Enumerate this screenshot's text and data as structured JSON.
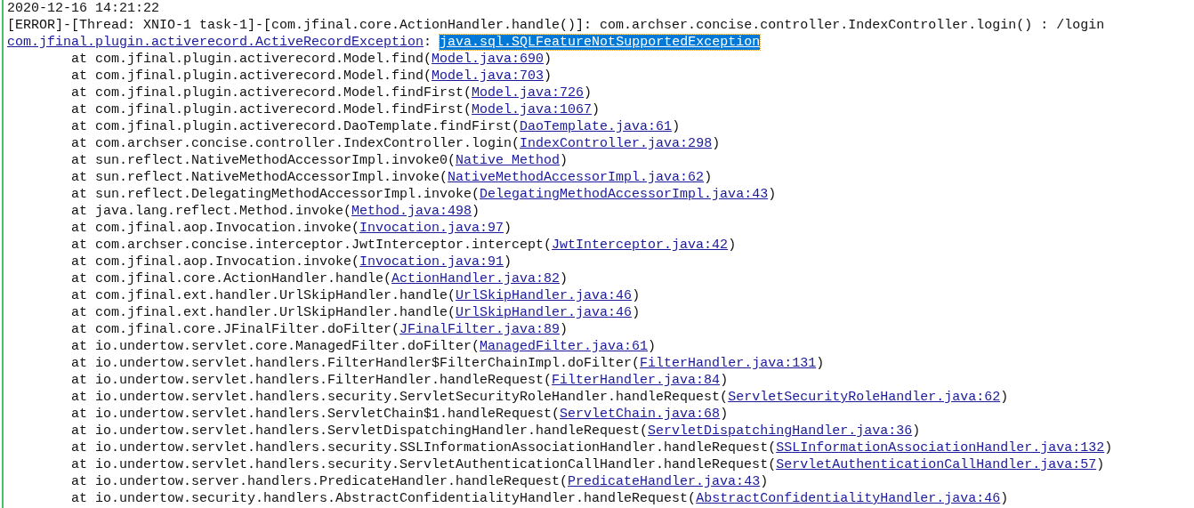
{
  "log": {
    "timestamp": "2020-12-16 14:21:22",
    "error_line": "[ERROR]-[Thread: XNIO-1 task-1]-[com.jfinal.core.ActionHandler.handle()]: com.archser.concise.controller.IndexController.login() : /login",
    "exception": {
      "link": "com.jfinal.plugin.activerecord.ActiveRecordException",
      "separator": ": ",
      "cause": "java.sql.SQLFeatureNotSupportedException",
      "selected": true
    },
    "frames": [
      {
        "prefix": "at com.jfinal.plugin.activerecord.Model.find(",
        "link": "Model.java:690",
        "suffix": ")"
      },
      {
        "prefix": "at com.jfinal.plugin.activerecord.Model.find(",
        "link": "Model.java:703",
        "suffix": ")"
      },
      {
        "prefix": "at com.jfinal.plugin.activerecord.Model.findFirst(",
        "link": "Model.java:726",
        "suffix": ")"
      },
      {
        "prefix": "at com.jfinal.plugin.activerecord.Model.findFirst(",
        "link": "Model.java:1067",
        "suffix": ")"
      },
      {
        "prefix": "at com.jfinal.plugin.activerecord.DaoTemplate.findFirst(",
        "link": "DaoTemplate.java:61",
        "suffix": ")"
      },
      {
        "prefix": "at com.archser.concise.controller.IndexController.login(",
        "link": "IndexController.java:298",
        "suffix": ")"
      },
      {
        "prefix": "at sun.reflect.NativeMethodAccessorImpl.invoke0(",
        "link": "Native Method",
        "suffix": ")"
      },
      {
        "prefix": "at sun.reflect.NativeMethodAccessorImpl.invoke(",
        "link": "NativeMethodAccessorImpl.java:62",
        "suffix": ")"
      },
      {
        "prefix": "at sun.reflect.DelegatingMethodAccessorImpl.invoke(",
        "link": "DelegatingMethodAccessorImpl.java:43",
        "suffix": ")"
      },
      {
        "prefix": "at java.lang.reflect.Method.invoke(",
        "link": "Method.java:498",
        "suffix": ")"
      },
      {
        "prefix": "at com.jfinal.aop.Invocation.invoke(",
        "link": "Invocation.java:97",
        "suffix": ")"
      },
      {
        "prefix": "at com.archser.concise.interceptor.JwtInterceptor.intercept(",
        "link": "JwtInterceptor.java:42",
        "suffix": ")"
      },
      {
        "prefix": "at com.jfinal.aop.Invocation.invoke(",
        "link": "Invocation.java:91",
        "suffix": ")"
      },
      {
        "prefix": "at com.jfinal.core.ActionHandler.handle(",
        "link": "ActionHandler.java:82",
        "suffix": ")"
      },
      {
        "prefix": "at com.jfinal.ext.handler.UrlSkipHandler.handle(",
        "link": "UrlSkipHandler.java:46",
        "suffix": ")"
      },
      {
        "prefix": "at com.jfinal.ext.handler.UrlSkipHandler.handle(",
        "link": "UrlSkipHandler.java:46",
        "suffix": ")"
      },
      {
        "prefix": "at com.jfinal.core.JFinalFilter.doFilter(",
        "link": "JFinalFilter.java:89",
        "suffix": ")"
      },
      {
        "prefix": "at io.undertow.servlet.core.ManagedFilter.doFilter(",
        "link": "ManagedFilter.java:61",
        "suffix": ")"
      },
      {
        "prefix": "at io.undertow.servlet.handlers.FilterHandler$FilterChainImpl.doFilter(",
        "link": "FilterHandler.java:131",
        "suffix": ")"
      },
      {
        "prefix": "at io.undertow.servlet.handlers.FilterHandler.handleRequest(",
        "link": "FilterHandler.java:84",
        "suffix": ")"
      },
      {
        "prefix": "at io.undertow.servlet.handlers.security.ServletSecurityRoleHandler.handleRequest(",
        "link": "ServletSecurityRoleHandler.java:62",
        "suffix": ")"
      },
      {
        "prefix": "at io.undertow.servlet.handlers.ServletChain$1.handleRequest(",
        "link": "ServletChain.java:68",
        "suffix": ")"
      },
      {
        "prefix": "at io.undertow.servlet.handlers.ServletDispatchingHandler.handleRequest(",
        "link": "ServletDispatchingHandler.java:36",
        "suffix": ")"
      },
      {
        "prefix": "at io.undertow.servlet.handlers.security.SSLInformationAssociationHandler.handleRequest(",
        "link": "SSLInformationAssociationHandler.java:132",
        "suffix": ")"
      },
      {
        "prefix": "at io.undertow.servlet.handlers.security.ServletAuthenticationCallHandler.handleRequest(",
        "link": "ServletAuthenticationCallHandler.java:57",
        "suffix": ")"
      },
      {
        "prefix": "at io.undertow.server.handlers.PredicateHandler.handleRequest(",
        "link": "PredicateHandler.java:43",
        "suffix": ")"
      },
      {
        "prefix": "at io.undertow.security.handlers.AbstractConfidentialityHandler.handleRequest(",
        "link": "AbstractConfidentialityHandler.java:46",
        "suffix": ")"
      }
    ]
  }
}
